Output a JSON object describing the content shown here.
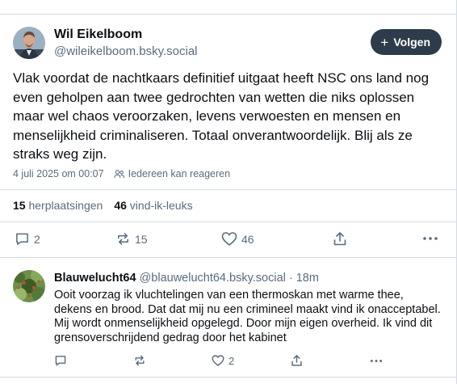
{
  "post": {
    "author_name": "Wil Eikelboom",
    "author_handle": "@wileikelboom.bsky.social",
    "follow_label": "Volgen",
    "text": "Vlak voordat de nachtkaars definitief uitgaat heeft NSC ons land nog even geholpen aan twee gedrochten van wetten die niks oplossen maar wel chaos veroorzaken, levens verwoesten en mensen en menselijkheid criminaliseren. Totaal onverantwoordelijk. Blij als ze straks weg zijn.",
    "timestamp": "4 juli 2025 om 00:07",
    "reply_permission": "Iedereen kan reageren",
    "reposts_count": "15",
    "reposts_label": "herplaatsingen",
    "likes_count": "46",
    "likes_label": "vind-ik-leuks",
    "actions": {
      "reply_count": "2",
      "repost_count": "15",
      "like_count": "46"
    }
  },
  "reply": {
    "author_name": "Blauwelucht64",
    "author_handle": "@blauwelucht64.bsky.social",
    "age": "· 18m",
    "text": "Ooit voorzag ik vluchtelingen van een thermoskan met warme thee, dekens en brood. Dat dat mij nu een crimineel maakt vind ik onacceptabel. Mij wordt onmenselijkheid opgelegd. Door mijn eigen overheid. Ik vind dit grensoverschrijdend gedrag door het kabinet",
    "like_count": "2"
  },
  "icons": {
    "reply": "speech-bubble-icon",
    "repost": "repost-arrows-icon",
    "like": "heart-icon",
    "share": "share-icon",
    "more": "ellipsis-icon",
    "permission": "people-icon",
    "follow": "plus-icon"
  },
  "colors": {
    "text": "#0b0f14",
    "muted": "#5b6b7c",
    "border": "#d4dbe2",
    "follow_button": "#2e3b4a"
  }
}
